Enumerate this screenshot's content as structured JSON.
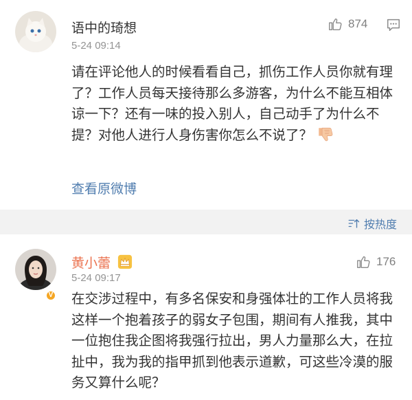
{
  "comments": [
    {
      "username": "语中的琦想",
      "time": "5-24 09:14",
      "likes": "874",
      "body": "请在评论他人的时候看看自己，抓伤工作人员你就有理了？工作人员每天接待那么多游客，为什么不能互相体谅一下？还有一味的投入别人，自己动手了为什么不提？对他人进行人身伤害你怎么不说了？",
      "reaction_icon": "thumbs-down-emoji",
      "view_original": "查看原微博"
    },
    {
      "username": "黄小蕾",
      "time": "5-24 09:17",
      "likes": "176",
      "body": "在交涉过程中，有多名保安和身强体壮的工作人员将我这样一个抱着孩子的弱女子包围，期间有人推我，其中一位抱住我企图将我强行拉出，男人力量那么大，在拉扯中，我为我的指甲抓到他表示道歉，可这些冷漠的服务又算什么呢？",
      "badge": "V"
    }
  ],
  "sort": {
    "label": "按热度"
  },
  "colors": {
    "link": "#507daf",
    "vip_name": "#eb7350",
    "meta": "#939393",
    "band": "#f2f2f2"
  }
}
